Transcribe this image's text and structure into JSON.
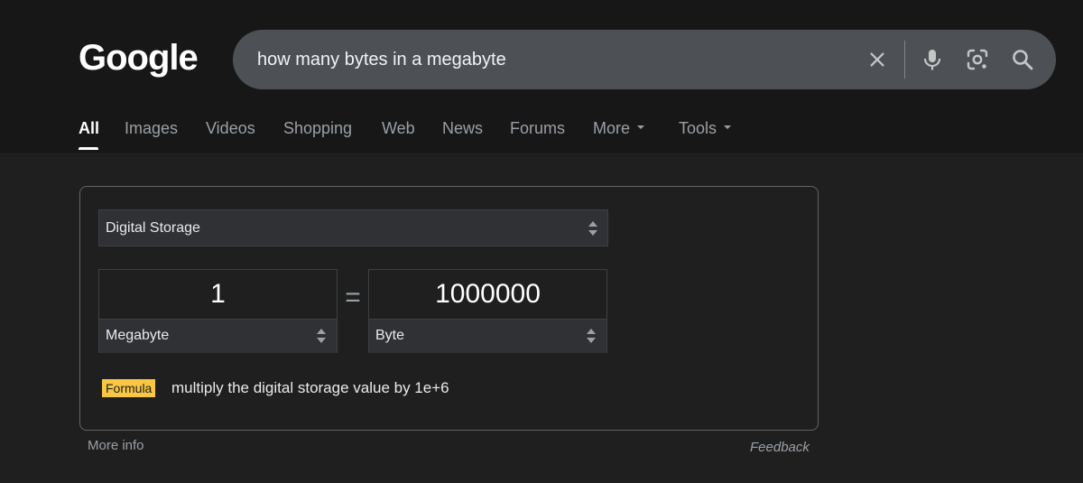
{
  "header": {
    "logo": "Google",
    "search": {
      "query": "how many bytes in a megabyte"
    }
  },
  "tabs": [
    {
      "label": "All",
      "active": true
    },
    {
      "label": "Images"
    },
    {
      "label": "Videos"
    },
    {
      "label": "Shopping"
    },
    {
      "label": "Web"
    },
    {
      "label": "News"
    },
    {
      "label": "Forums"
    },
    {
      "label": "More"
    },
    {
      "label": "Tools"
    }
  ],
  "converter": {
    "category": "Digital Storage",
    "from": {
      "value": "1",
      "unit": "Megabyte"
    },
    "equals": "=",
    "to": {
      "value": "1000000",
      "unit": "Byte"
    },
    "formula_badge": "Formula",
    "formula_text": "multiply the digital storage value by 1e+6"
  },
  "footer": {
    "more_info": "More info",
    "feedback": "Feedback"
  },
  "colors": {
    "header_bg": "#171717",
    "page_bg": "#1f1f1f",
    "searchbar_bg": "#4d5156",
    "formula_badge_bg": "#f9c741"
  }
}
